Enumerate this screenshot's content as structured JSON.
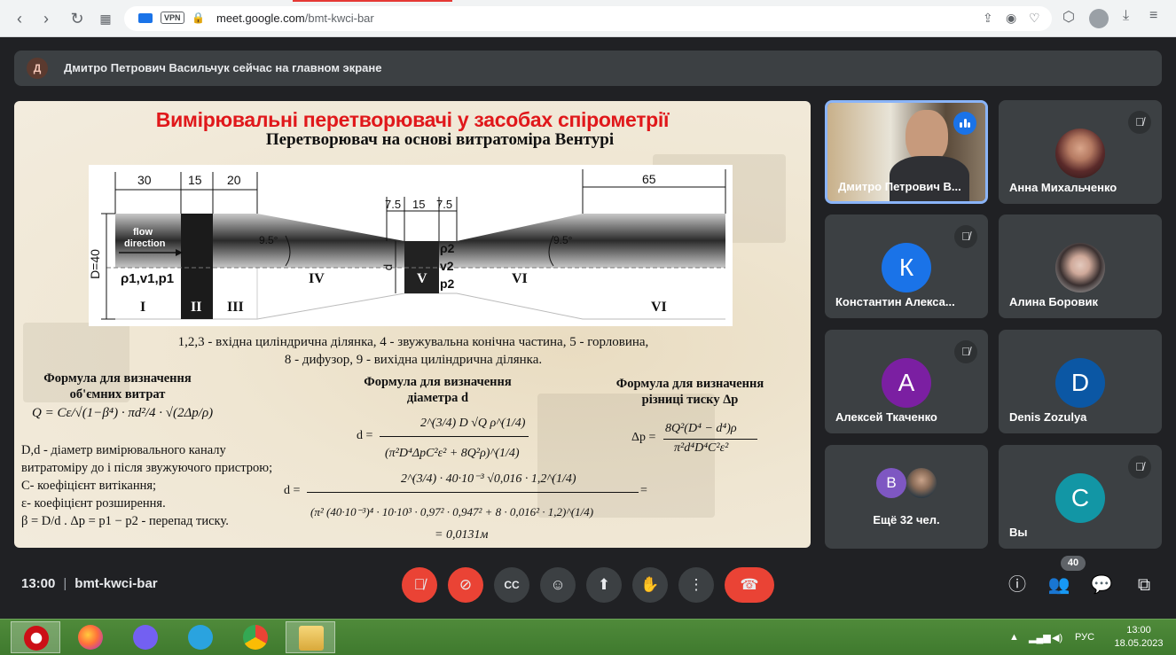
{
  "browser": {
    "url_host": "meet.google.com",
    "url_path": "/bmt-kwci-bar",
    "vpn_label": "VPN"
  },
  "banner": {
    "avatar_initial": "Д",
    "text": "Дмитро Петрович Васильчук сейчас на главном экране"
  },
  "slide": {
    "title": "Вимірювальні перетворювачі у засобах спірометрії",
    "subtitle": "Перетворювач на основі витратоміра Вентурі",
    "diagram": {
      "dims_top": [
        "30",
        "15",
        "20",
        "7.5",
        "15",
        "7.5",
        "65"
      ],
      "flow_label_1": "flow",
      "flow_label_2": "direction",
      "d40": "D=40",
      "rho_v_p_1": "ρ1,v1,p1",
      "angle_left": "9.5°",
      "angle_right": "9.5°",
      "small_d": "d",
      "rho2": "ρ2",
      "v2": "v2",
      "p2": "p2",
      "sections": [
        "I",
        "II",
        "III",
        "IV",
        "V",
        "VI",
        "VI"
      ]
    },
    "caption_line1": "1,2,3 - вхідна циліндрична ділянка, 4 - звужувальна конічна частина, 5 - горловина,",
    "caption_line2": "8 - дифузор, 9 - вихідна циліндрична ділянка.",
    "left_heading_1": "Формула для визначення",
    "left_heading_2": "об'ємних витрат",
    "left_formula": "Q = Cε/√(1−β⁴) · πd²/4 · √(2Δp/ρ)",
    "left_text": [
      "D,d  - діаметр вимірювального каналу",
      "витратоміру до і після звужуючого пристрою;",
      "C- коефіцієнт витікання;",
      "ε- коефіцієнт розширення.",
      "β = D/d .   Δp = p1 − p2 - перепад тиску."
    ],
    "mid_heading_1": "Формула для визначення",
    "mid_heading_2": "діаметра d",
    "mid_formula_num": "2^(3/4) D √Q ρ^(1/4)",
    "mid_formula_den": "(π²D⁴ΔpC²ε² + 8Q²ρ)^(1/4)",
    "calc_num": "2^(3/4) · 40·10⁻³ √0,016 · 1,2^(1/4)",
    "calc_den": "(π² (40·10⁻³)⁴ · 10·10³ · 0,97² · 0,947² + 8 · 0,016² · 1,2)^(1/4)",
    "calc_result": "= 0,0131м",
    "right_heading_1": "Формула для визначення",
    "right_heading_2": "різниці тиску Δp",
    "right_formula_num": "8Q²(D⁴ − d⁴)ρ",
    "right_formula_den": "π²d⁴D⁴C²ε²"
  },
  "participants": [
    {
      "name": "Дмитро Петрович В...",
      "speaking": true
    },
    {
      "name": "Анна Михальченко",
      "muted": true
    },
    {
      "name": "Константин Алекса...",
      "initial": "К",
      "color": "#1a73e8",
      "muted": true
    },
    {
      "name": "Алина Боровик"
    },
    {
      "name": "Алексей Ткаченко",
      "initial": "А",
      "color": "#7b1fa2",
      "muted": true
    },
    {
      "name": "Denis Zozulya",
      "initial": "D",
      "color": "#0b57a4"
    },
    {
      "name": "Ещё 32 чел.",
      "initial": "В",
      "color": "#7e57c2"
    },
    {
      "name": "Вы",
      "initial": "C",
      "color": "#1296a5",
      "muted": true
    }
  ],
  "bottom_bar": {
    "time": "13:00",
    "meeting_code": "bmt-kwci-bar",
    "participant_count": "40"
  },
  "taskbar": {
    "lang": "РУС",
    "clock_time": "13:00",
    "clock_date": "18.05.2023"
  },
  "colors": {
    "meet_bg": "#202124",
    "tile_bg": "#3c4043",
    "red": "#ea4335",
    "title_red": "#e0181b",
    "taskbar_green": "#4f8a3a"
  }
}
